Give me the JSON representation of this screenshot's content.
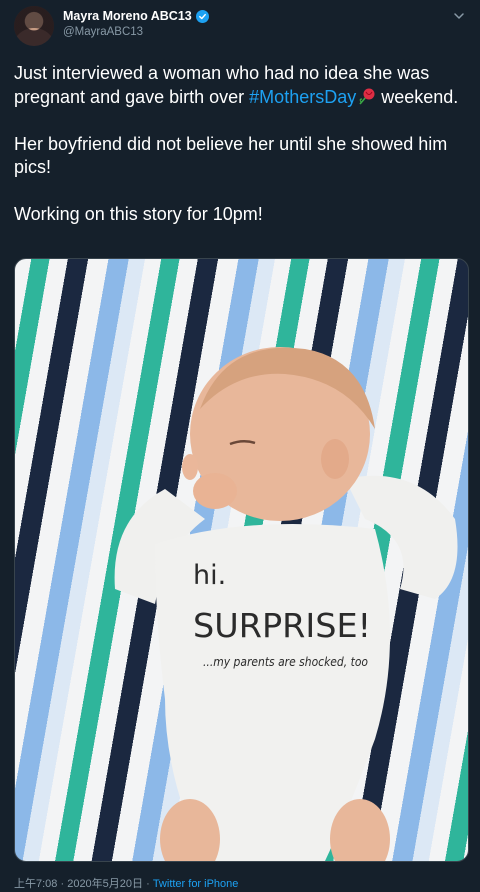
{
  "author": {
    "display_name": "Mayra Moreno ABC13",
    "handle": "@MayraABC13"
  },
  "tweet": {
    "line1_prefix": "Just interviewed a woman who had no idea she was pregnant and gave birth over ",
    "hashtag": "#MothersDay",
    "line1_suffix": " weekend.",
    "paragraph2": "Her boyfriend did not believe her until she showed him pics!",
    "paragraph3": "Working on this story for 10pm!"
  },
  "media": {
    "onesie_line1": "hi.",
    "onesie_line2": "SURPRISE!",
    "onesie_line3": "...my parents are shocked, too"
  },
  "meta": {
    "time": "上午7:08",
    "separator": " · ",
    "date": "2020年5月20日",
    "source": "Twitter for iPhone"
  },
  "colors": {
    "background": "#15202b",
    "link": "#1da1f2",
    "muted": "#8899a6"
  },
  "icons": [
    "verified-badge-icon",
    "chevron-down-icon",
    "rose-emoji-icon"
  ]
}
